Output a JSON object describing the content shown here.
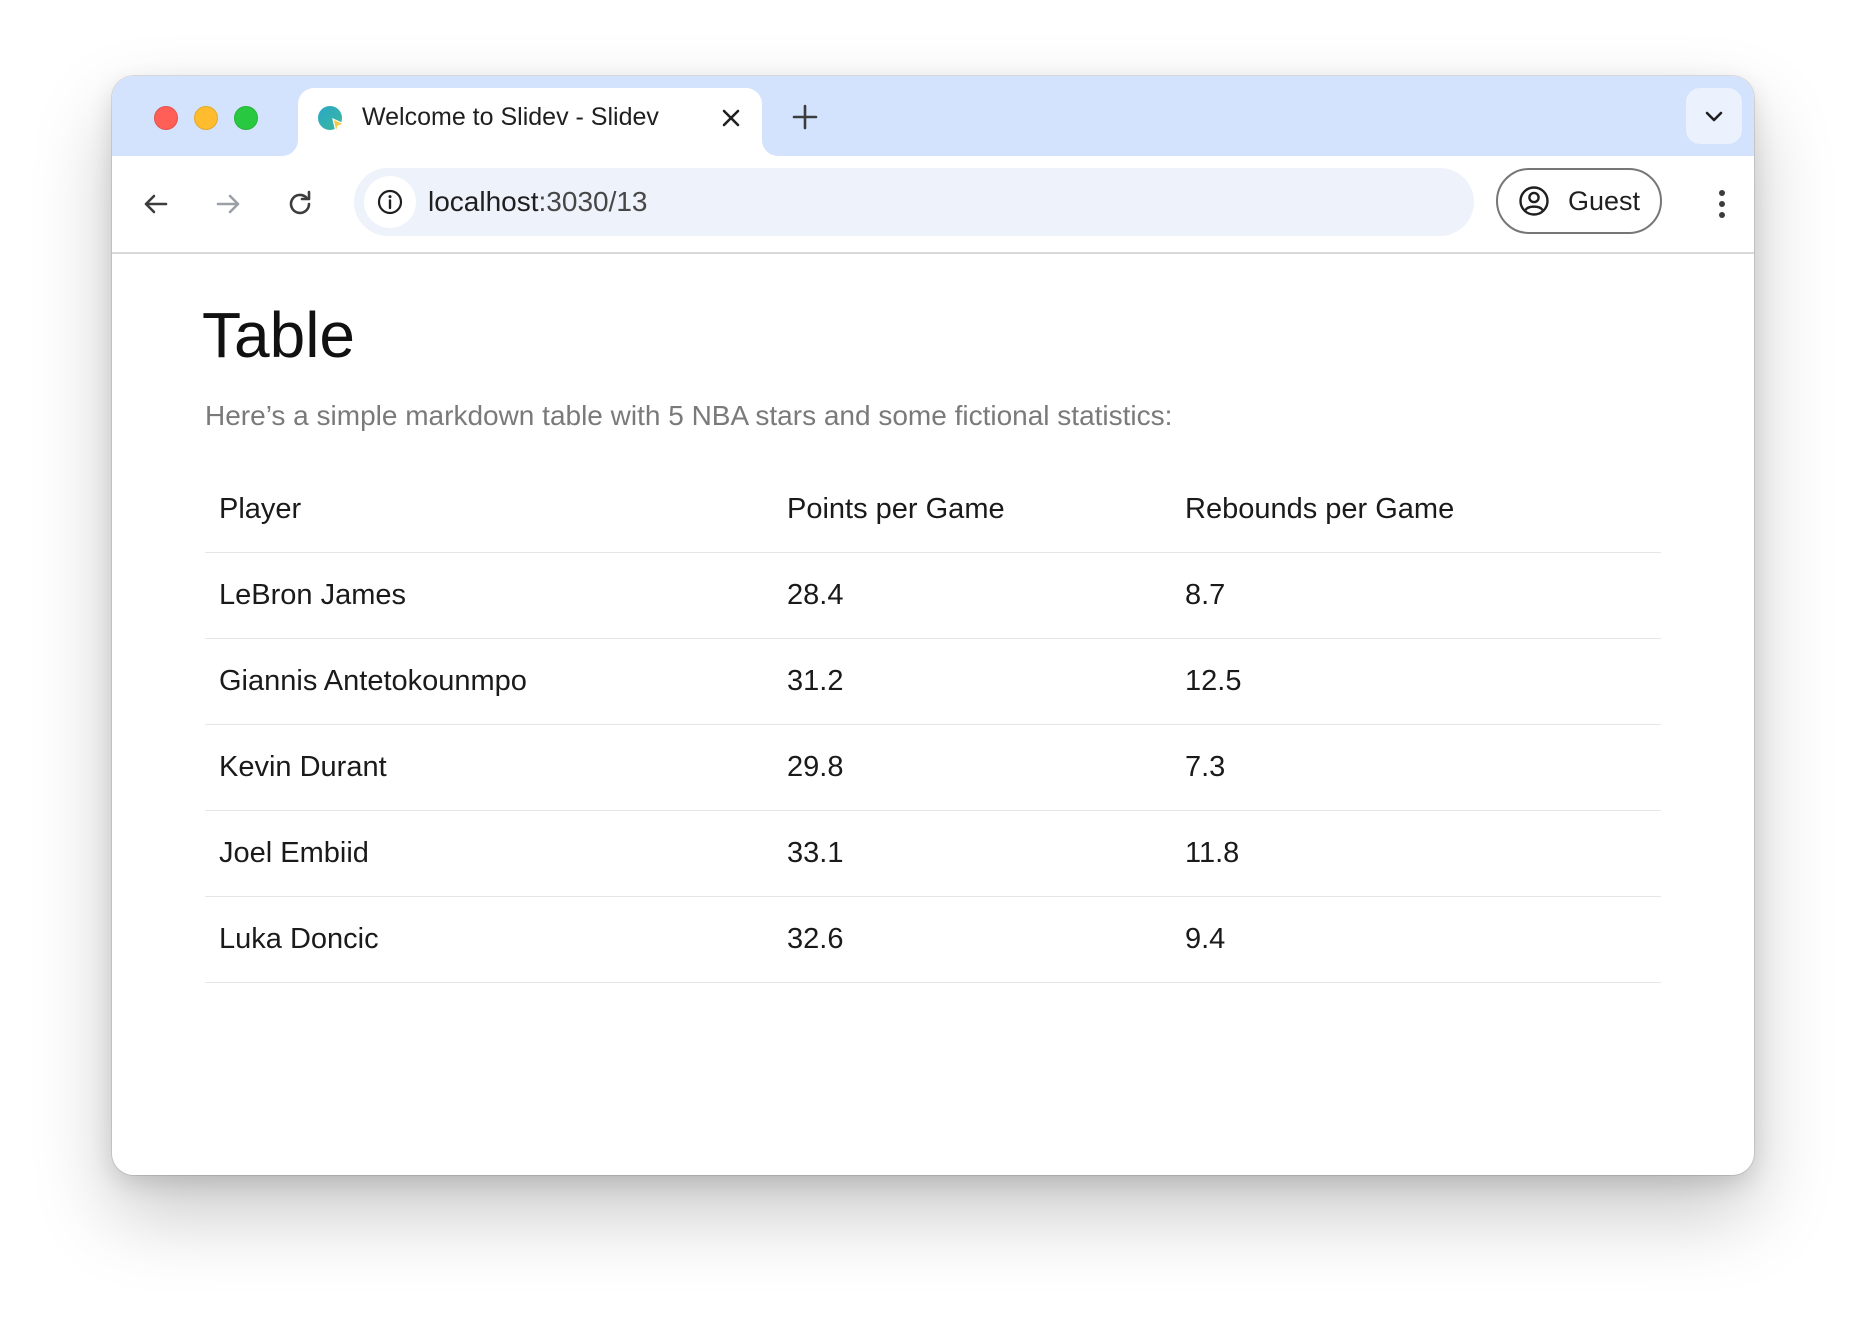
{
  "browser": {
    "tab": {
      "title": "Welcome to Slidev - Slidev"
    },
    "address": {
      "host": "localhost",
      "path": ":3030/13"
    },
    "profile": {
      "label": "Guest"
    }
  },
  "slide": {
    "title": "Table",
    "subtitle": "Here’s a simple markdown table with 5 NBA stars and some fictional statistics:",
    "table": {
      "headers": [
        "Player",
        "Points per Game",
        "Rebounds per Game"
      ],
      "rows": [
        [
          "LeBron James",
          "28.4",
          "8.7"
        ],
        [
          "Giannis Antetokounmpo",
          "31.2",
          "12.5"
        ],
        [
          "Kevin Durant",
          "29.8",
          "7.3"
        ],
        [
          "Joel Embiid",
          "33.1",
          "11.8"
        ],
        [
          "Luka Doncic",
          "32.6",
          "9.4"
        ]
      ]
    }
  },
  "colors": {
    "tabstrip": "#d3e3fd",
    "omnibox": "#edf2fb",
    "close_dot": "#ff5f57",
    "minimize_dot": "#febc2e",
    "zoom_dot": "#28c840"
  }
}
